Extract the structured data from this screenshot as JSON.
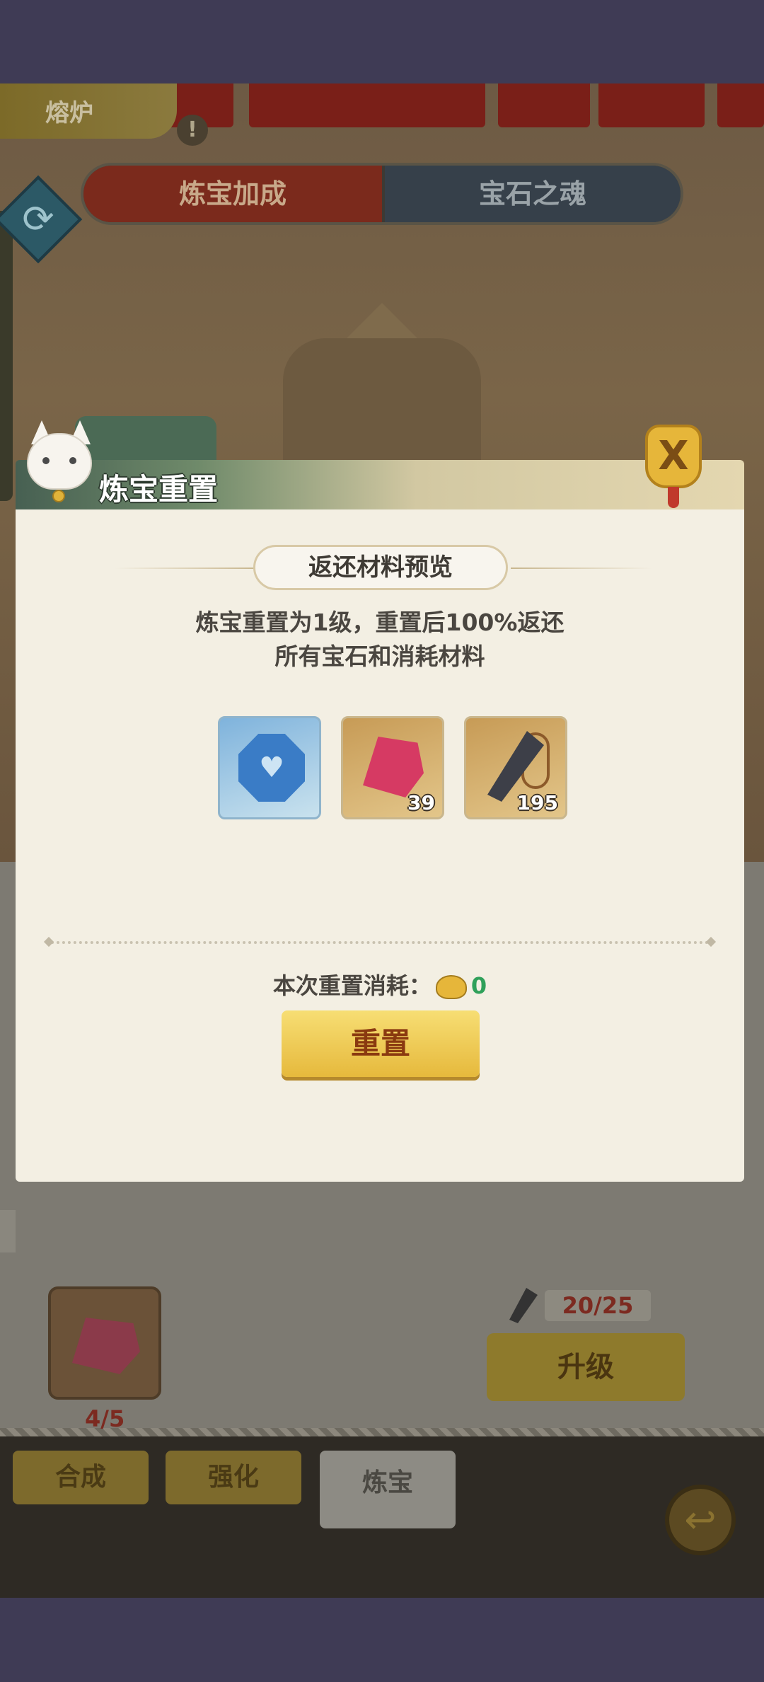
{
  "background": {
    "forge_tab": "熔炉",
    "tab_bonus": "炼宝加成",
    "tab_gem_soul": "宝石之魂",
    "material_count": "4/5",
    "resource_count": "20/25",
    "upgrade_label": "升级",
    "bottom_tabs": [
      "合成",
      "强化",
      "炼宝"
    ]
  },
  "dialog": {
    "title": "炼宝重置",
    "subtitle": "返还材料预览",
    "description_line1": "炼宝重置为1级，重置后100%返还",
    "description_line2": "所有宝石和消耗材料",
    "items": [
      {
        "name": "blue-gem",
        "count": ""
      },
      {
        "name": "red-gem",
        "count": "39"
      },
      {
        "name": "hammer-tool",
        "count": "195"
      }
    ],
    "cost_label": "本次重置消耗：",
    "cost_value": "0",
    "reset_button": "重置"
  },
  "colors": {
    "accent_gold": "#e6b93c",
    "cost_green": "#2fa05a",
    "panel_bg": "#f3efe3"
  }
}
